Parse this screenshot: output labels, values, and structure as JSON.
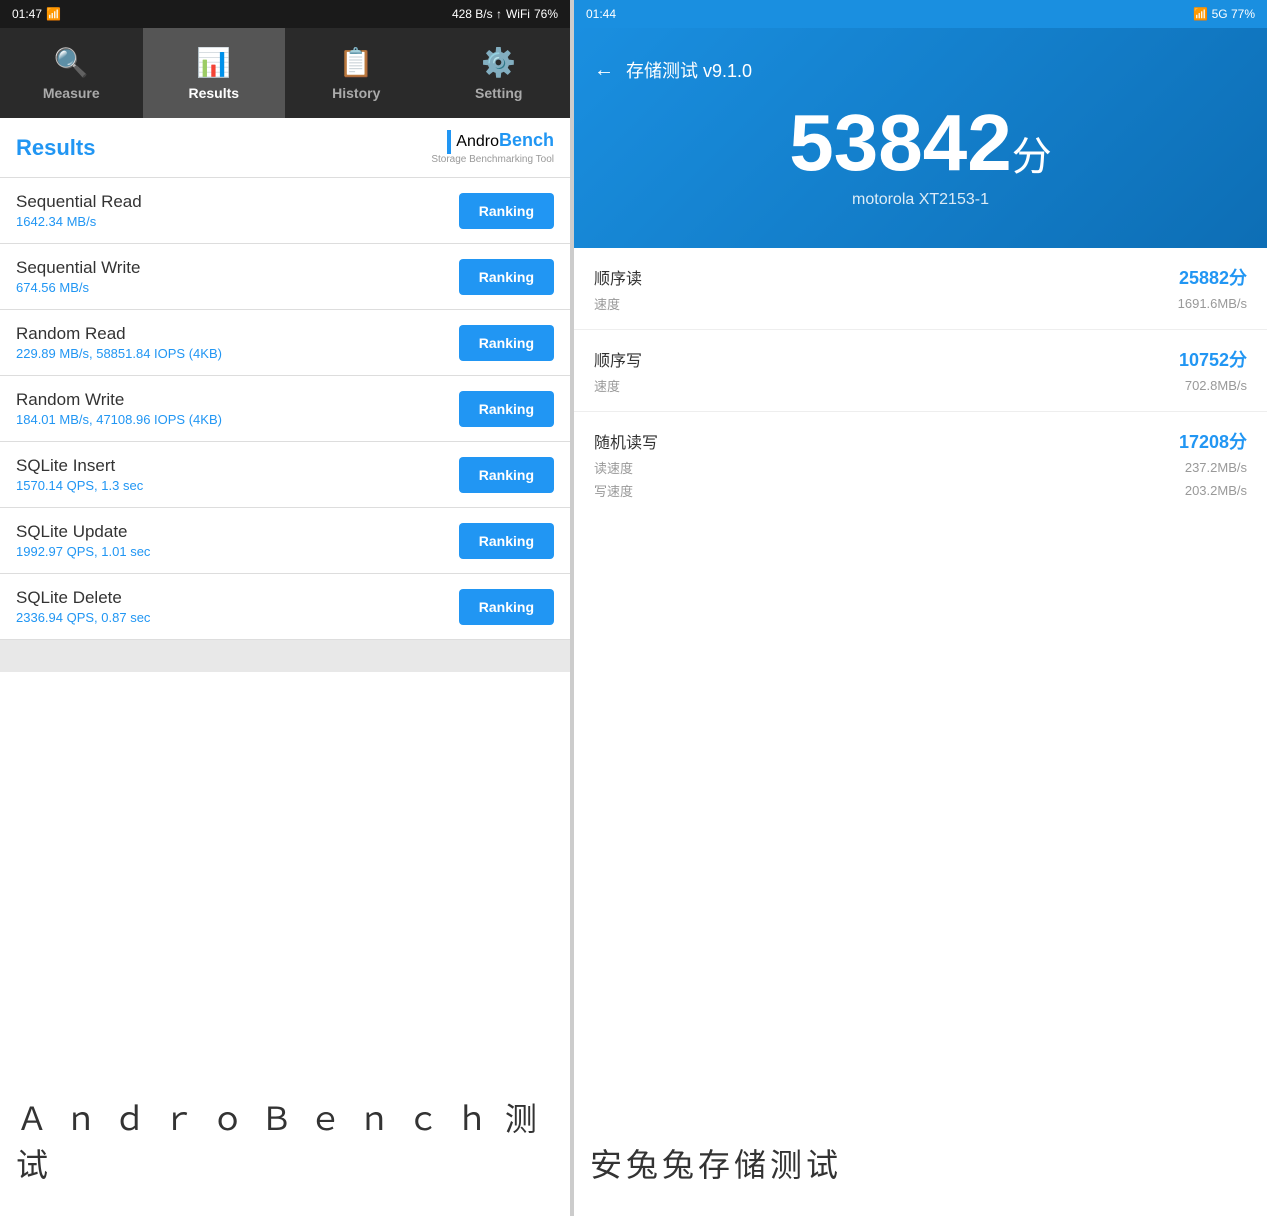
{
  "left": {
    "statusBar": {
      "time": "01:47",
      "signal": "|||",
      "battery": "76%",
      "dataUp": "428",
      "dataDown": "B/s"
    },
    "navTabs": [
      {
        "id": "measure",
        "label": "Measure",
        "icon": "🔍",
        "active": false
      },
      {
        "id": "results",
        "label": "Results",
        "icon": "📊",
        "active": true
      },
      {
        "id": "history",
        "label": "History",
        "icon": "📋",
        "active": false
      },
      {
        "id": "setting",
        "label": "Setting",
        "icon": "⚙️",
        "active": false
      }
    ],
    "resultsTitle": "Results",
    "logo": {
      "andro": "Andro",
      "bench": "Bench",
      "subtitle": "Storage Benchmarking Tool"
    },
    "benchmarks": [
      {
        "name": "Sequential Read",
        "value": "1642.34 MB/s",
        "buttonLabel": "Ranking"
      },
      {
        "name": "Sequential Write",
        "value": "674.56 MB/s",
        "buttonLabel": "Ranking"
      },
      {
        "name": "Random Read",
        "value": "229.89 MB/s, 58851.84 IOPS (4KB)",
        "buttonLabel": "Ranking"
      },
      {
        "name": "Random Write",
        "value": "184.01 MB/s, 47108.96 IOPS (4KB)",
        "buttonLabel": "Ranking"
      },
      {
        "name": "SQLite Insert",
        "value": "1570.14 QPS, 1.3 sec",
        "buttonLabel": "Ranking"
      },
      {
        "name": "SQLite Update",
        "value": "1992.97 QPS, 1.01 sec",
        "buttonLabel": "Ranking"
      },
      {
        "name": "SQLite Delete",
        "value": "2336.94 QPS, 0.87 sec",
        "buttonLabel": "Ranking"
      }
    ],
    "bottomLabel": "Ａ ｎ ｄ ｒ ｏ Ｂ ｅ ｎ ｃ ｈ 测试"
  },
  "right": {
    "statusBar": {
      "time": "01:44",
      "battery": "77%"
    },
    "backLabel": "←",
    "appTitle": "存储测试 v9.1.0",
    "mainScore": "53842",
    "scoreUnit": "分",
    "deviceName": "motorola XT2153-1",
    "stats": [
      {
        "labelCn": "顺序读",
        "score": "25882分",
        "subRows": [
          {
            "label": "速度",
            "value": "1691.6MB/s"
          }
        ]
      },
      {
        "labelCn": "顺序写",
        "score": "10752分",
        "subRows": [
          {
            "label": "速度",
            "value": "702.8MB/s"
          }
        ]
      },
      {
        "labelCn": "随机读写",
        "score": "17208分",
        "subRows": [
          {
            "label": "读速度",
            "value": "237.2MB/s"
          },
          {
            "label": "写速度",
            "value": "203.2MB/s"
          }
        ]
      }
    ],
    "bottomLabel": "安兔兔存储测试"
  }
}
